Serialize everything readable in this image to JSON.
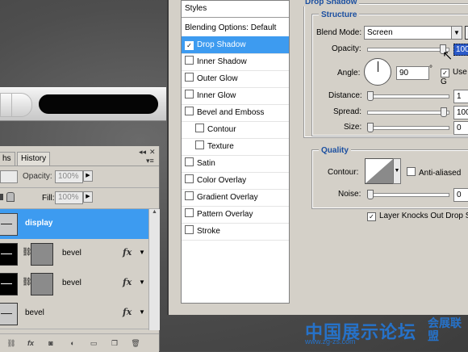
{
  "layers_panel": {
    "tabs": [
      "hs",
      "History"
    ],
    "opacity_label": "Opacity:",
    "opacity_value": "100%",
    "fill_label": "Fill:",
    "fill_value": "100%",
    "fx_label": "fx",
    "layers": [
      {
        "name": "display",
        "selected": true
      },
      {
        "name": "bevel",
        "selected": false,
        "fx": true
      },
      {
        "name": "bevel",
        "selected": false,
        "fx": true
      },
      {
        "name": "bevel",
        "selected": false,
        "fx": true
      }
    ]
  },
  "dialog": {
    "styles_header": "Styles",
    "style_items": [
      {
        "label": "Blending Options: Default",
        "checkbox": false,
        "checked": false,
        "indent": false
      },
      {
        "label": "Drop Shadow",
        "checkbox": true,
        "checked": true,
        "indent": false,
        "active": true
      },
      {
        "label": "Inner Shadow",
        "checkbox": true,
        "checked": false,
        "indent": false
      },
      {
        "label": "Outer Glow",
        "checkbox": true,
        "checked": false,
        "indent": false
      },
      {
        "label": "Inner Glow",
        "checkbox": true,
        "checked": false,
        "indent": false
      },
      {
        "label": "Bevel and Emboss",
        "checkbox": true,
        "checked": false,
        "indent": false
      },
      {
        "label": "Contour",
        "checkbox": true,
        "checked": false,
        "indent": true
      },
      {
        "label": "Texture",
        "checkbox": true,
        "checked": false,
        "indent": true
      },
      {
        "label": "Satin",
        "checkbox": true,
        "checked": false,
        "indent": false
      },
      {
        "label": "Color Overlay",
        "checkbox": true,
        "checked": false,
        "indent": false
      },
      {
        "label": "Gradient Overlay",
        "checkbox": true,
        "checked": false,
        "indent": false
      },
      {
        "label": "Pattern Overlay",
        "checkbox": true,
        "checked": false,
        "indent": false
      },
      {
        "label": "Stroke",
        "checkbox": true,
        "checked": false,
        "indent": false
      }
    ],
    "section_title": "Drop Shadow",
    "structure_title": "Structure",
    "blend_mode_label": "Blend Mode:",
    "blend_mode_value": "Screen",
    "opacity_label": "Opacity:",
    "opacity_value": "100",
    "angle_label": "Angle:",
    "angle_value": "90",
    "degree_symbol": "°",
    "use_global_label": "Use G",
    "distance_label": "Distance:",
    "distance_value": "1",
    "spread_label": "Spread:",
    "spread_value": "100",
    "size_label": "Size:",
    "size_value": "0",
    "quality_title": "Quality",
    "contour_label": "Contour:",
    "anti_aliased_label": "Anti-aliased",
    "noise_label": "Noise:",
    "noise_value": "0",
    "knockout_label": "Layer Knocks Out Drop S"
  },
  "watermark": {
    "main": "中国展示论坛",
    "url": "www.zg-zs.com",
    "side": "会展联盟"
  },
  "colors": {
    "selection_blue": "#3d9bf0",
    "header_blue": "#1b4fa0",
    "watermark_blue": "#2672c9"
  }
}
